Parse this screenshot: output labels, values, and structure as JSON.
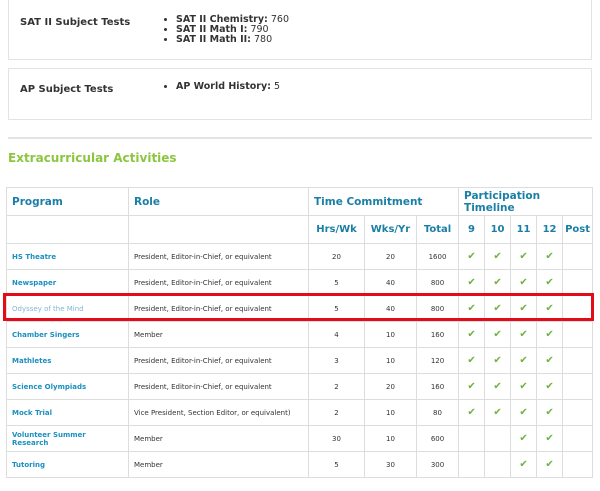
{
  "sat2": {
    "label": "SAT II Subject Tests",
    "items": [
      {
        "name": "SAT II Chemistry:",
        "score": "760"
      },
      {
        "name": "SAT II Math I:",
        "score": "790"
      },
      {
        "name": "SAT II Math II:",
        "score": "780"
      }
    ]
  },
  "ap": {
    "label": "AP Subject Tests",
    "items": [
      {
        "name": "AP World History:",
        "score": "5"
      }
    ]
  },
  "extracurricular": {
    "title": "Extracurricular Activities",
    "headers": {
      "program": "Program",
      "role": "Role",
      "time_commitment": "Time Commitment",
      "participation_timeline": "Participation Timeline",
      "hrs_wk": "Hrs/Wk",
      "wks_yr": "Wks/Yr",
      "total": "Total",
      "g9": "9",
      "g10": "10",
      "g11": "11",
      "g12": "12",
      "post": "Post"
    },
    "check_symbol": "✔",
    "rows": [
      {
        "program": "HS Theatre",
        "role": "President, Editor-in-Chief, or equivalent",
        "hrs": "20",
        "wks": "20",
        "total": "1600",
        "g9": true,
        "g10": true,
        "g11": true,
        "g12": true,
        "post": false
      },
      {
        "program": "Newspaper",
        "role": "President, Editor-in-Chief, or equivalent",
        "hrs": "5",
        "wks": "40",
        "total": "800",
        "g9": true,
        "g10": true,
        "g11": true,
        "g12": true,
        "post": false
      },
      {
        "program": "Odyssey of the Mind",
        "role": "President, Editor-in-Chief, or equivalent",
        "hrs": "5",
        "wks": "40",
        "total": "800",
        "g9": true,
        "g10": true,
        "g11": true,
        "g12": true,
        "post": false,
        "highlighted": true
      },
      {
        "program": "Chamber Singers",
        "role": "Member",
        "hrs": "4",
        "wks": "10",
        "total": "160",
        "g9": true,
        "g10": true,
        "g11": true,
        "g12": true,
        "post": false
      },
      {
        "program": "Mathletes",
        "role": "President, Editor-in-Chief, or equivalent",
        "hrs": "3",
        "wks": "10",
        "total": "120",
        "g9": true,
        "g10": true,
        "g11": true,
        "g12": true,
        "post": false
      },
      {
        "program": "Science Olympiads",
        "role": "President, Editor-in-Chief, or equivalent",
        "hrs": "2",
        "wks": "20",
        "total": "160",
        "g9": true,
        "g10": true,
        "g11": true,
        "g12": true,
        "post": false
      },
      {
        "program": "Mock Trial",
        "role": "Vice President, Section Editor, or equivalent)",
        "hrs": "2",
        "wks": "10",
        "total": "80",
        "g9": true,
        "g10": true,
        "g11": true,
        "g12": true,
        "post": false
      },
      {
        "program": "Volunteer Summer Research",
        "role": "Member",
        "hrs": "30",
        "wks": "10",
        "total": "600",
        "g9": false,
        "g10": false,
        "g11": true,
        "g12": true,
        "post": false
      },
      {
        "program": "Tutoring",
        "role": "Member",
        "hrs": "5",
        "wks": "30",
        "total": "300",
        "g9": false,
        "g10": false,
        "g11": true,
        "g12": true,
        "post": false
      }
    ]
  },
  "colors": {
    "section_title": "#8cc63f",
    "header_text": "#1a7fa6",
    "program_link": "#1a8fc1",
    "check": "#6db33f",
    "highlight_border": "#e30b17"
  }
}
